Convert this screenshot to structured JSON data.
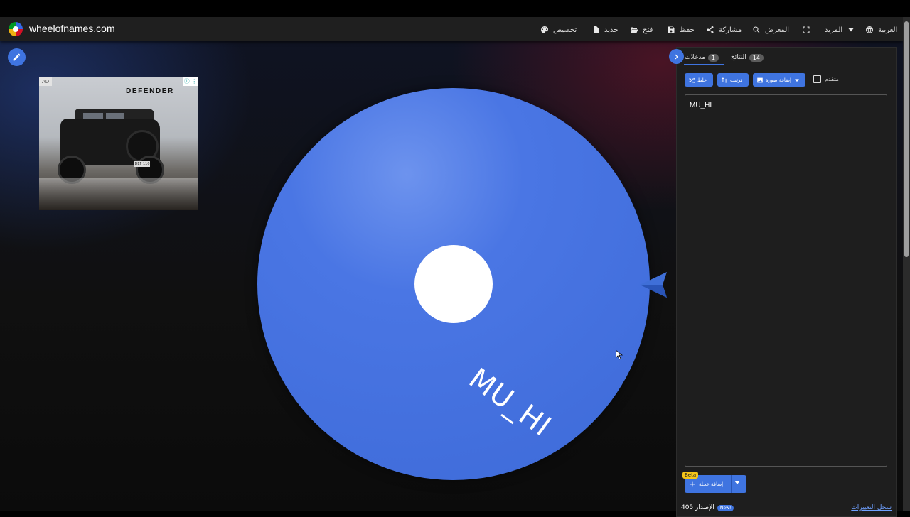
{
  "site": {
    "title": "wheelofnames.com"
  },
  "nav": {
    "customize": "تخصيص",
    "new": "جديد",
    "open": "فتح",
    "save": "حفظ",
    "share": "مشاركة",
    "gallery": "المعرض",
    "more": "المزيد",
    "language": "العربية"
  },
  "ad": {
    "badge": "AD",
    "brand": "DEFENDER",
    "plate": "DEF 110"
  },
  "wheel": {
    "label": "MU_HI",
    "color": "#4a76e4"
  },
  "panel": {
    "tabs": [
      {
        "label": "مدخلات",
        "count": "1"
      },
      {
        "label": "النتائج",
        "count": "14"
      }
    ],
    "toolbar": {
      "shuffle": "خلط",
      "sort": "ترتيب",
      "add_image": "إضافة صورة",
      "advanced": "متقدم"
    },
    "entries": [
      "MU_HI"
    ],
    "add_wheel": "إضافة عجلة",
    "beta": "Beta",
    "bottom": {
      "version": "الإصدار 405",
      "new": "New!",
      "changelog": "سجل التغييرات"
    }
  }
}
